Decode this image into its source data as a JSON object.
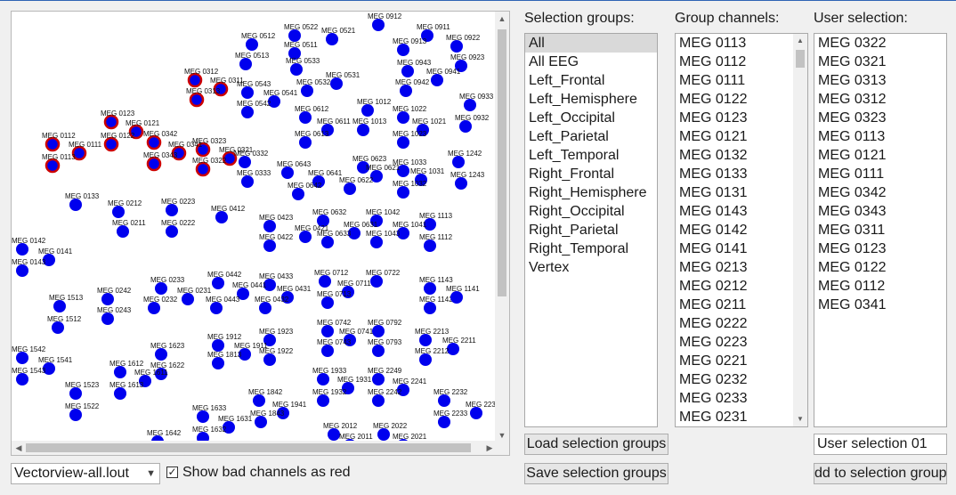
{
  "colors": {
    "sensor": "#0000ee",
    "bad": "#cc0000",
    "accent": "#2f64b4"
  },
  "headers": {
    "selection_groups": "Selection groups:",
    "group_channels": "Group channels:",
    "user_selection": "User selection:"
  },
  "selection_groups": [
    "All",
    "All EEG",
    "Left_Frontal",
    "Left_Hemisphere",
    "Left_Occipital",
    "Left_Parietal",
    "Left_Temporal",
    "Right_Frontal",
    "Right_Hemisphere",
    "Right_Occipital",
    "Right_Parietal",
    "Right_Temporal",
    "Vertex"
  ],
  "selected_group": "All",
  "group_channels": [
    "MEG 0113",
    "MEG 0112",
    "MEG 0111",
    "MEG 0122",
    "MEG 0123",
    "MEG 0121",
    "MEG 0132",
    "MEG 0133",
    "MEG 0131",
    "MEG 0143",
    "MEG 0142",
    "MEG 0141",
    "MEG 0213",
    "MEG 0212",
    "MEG 0211",
    "MEG 0222",
    "MEG 0223",
    "MEG 0221",
    "MEG 0232",
    "MEG 0233",
    "MEG 0231"
  ],
  "user_selection": [
    "MEG 0322",
    "MEG 0321",
    "MEG 0313",
    "MEG 0312",
    "MEG 0323",
    "MEG 0113",
    "MEG 0121",
    "MEG 0111",
    "MEG 0342",
    "MEG 0343",
    "MEG 0311",
    "MEG 0123",
    "MEG 0122",
    "MEG 0112",
    "MEG 0341"
  ],
  "buttons": {
    "load": "Load selection groups",
    "save": "Save selection groups",
    "add": "dd to selection group"
  },
  "new_group_name": "User selection 01",
  "layout_select": "Vectorview-all.lout",
  "checkbox_label": "Show bad channels as red",
  "checkbox_checked": true,
  "sensors": [
    {
      "id": "MEG 0522",
      "bad": false
    },
    {
      "id": "MEG 0912",
      "bad": false
    },
    {
      "id": "MEG 0911",
      "bad": false
    },
    {
      "id": "MEG 0521",
      "bad": false
    },
    {
      "id": "MEG 0913",
      "bad": false
    },
    {
      "id": "MEG 0922",
      "bad": false
    },
    {
      "id": "MEG 0512",
      "bad": false
    },
    {
      "id": "MEG 0511",
      "bad": false
    },
    {
      "id": "MEG 0923",
      "bad": false
    },
    {
      "id": "MEG 0513",
      "bad": false
    },
    {
      "id": "MEG 0533",
      "bad": false
    },
    {
      "id": "MEG 0943",
      "bad": false
    },
    {
      "id": "MEG 0941",
      "bad": false
    },
    {
      "id": "MEG 0312",
      "bad": true
    },
    {
      "id": "MEG 0311",
      "bad": true
    },
    {
      "id": "MEG 0313",
      "bad": true
    },
    {
      "id": "MEG 0543",
      "bad": false
    },
    {
      "id": "MEG 0541",
      "bad": false
    },
    {
      "id": "MEG 0532",
      "bad": false
    },
    {
      "id": "MEG 0531",
      "bad": false
    },
    {
      "id": "MEG 0942",
      "bad": false
    },
    {
      "id": "MEG 0933",
      "bad": false
    },
    {
      "id": "MEG 0542",
      "bad": false
    },
    {
      "id": "MEG 0612",
      "bad": false
    },
    {
      "id": "MEG 1012",
      "bad": false
    },
    {
      "id": "MEG 1022",
      "bad": false
    },
    {
      "id": "MEG 0932",
      "bad": false
    },
    {
      "id": "MEG 0123",
      "bad": true
    },
    {
      "id": "MEG 0121",
      "bad": true
    },
    {
      "id": "MEG 0342",
      "bad": true
    },
    {
      "id": "MEG 0611",
      "bad": false
    },
    {
      "id": "MEG 1013",
      "bad": false
    },
    {
      "id": "MEG 1021",
      "bad": false
    },
    {
      "id": "MEG 0112",
      "bad": true
    },
    {
      "id": "MEG 0122",
      "bad": true
    },
    {
      "id": "MEG 0323",
      "bad": true
    },
    {
      "id": "MEG 0613",
      "bad": false
    },
    {
      "id": "MEG 1023",
      "bad": false
    },
    {
      "id": "MEG 0111",
      "bad": true
    },
    {
      "id": "MEG 0341",
      "bad": true
    },
    {
      "id": "MEG 0321",
      "bad": true
    },
    {
      "id": "MEG 0113",
      "bad": true
    },
    {
      "id": "MEG 0343",
      "bad": true
    },
    {
      "id": "MEG 0322",
      "bad": true
    },
    {
      "id": "MEG 0332",
      "bad": false
    },
    {
      "id": "MEG 0623",
      "bad": false
    },
    {
      "id": "MEG 1033",
      "bad": false
    },
    {
      "id": "MEG 1242",
      "bad": false
    },
    {
      "id": "MEG 0333",
      "bad": false
    },
    {
      "id": "MEG 0643",
      "bad": false
    },
    {
      "id": "MEG 0641",
      "bad": false
    },
    {
      "id": "MEG 0621",
      "bad": false
    },
    {
      "id": "MEG 1031",
      "bad": false
    },
    {
      "id": "MEG 1243",
      "bad": false
    },
    {
      "id": "MEG 0642",
      "bad": false
    },
    {
      "id": "MEG 0622",
      "bad": false
    },
    {
      "id": "MEG 1032",
      "bad": false
    },
    {
      "id": "MEG 0133",
      "bad": false
    },
    {
      "id": "MEG 0212",
      "bad": false
    },
    {
      "id": "MEG 0223",
      "bad": false
    },
    {
      "id": "MEG 0412",
      "bad": false
    },
    {
      "id": "MEG 0632",
      "bad": false
    },
    {
      "id": "MEG 1042",
      "bad": false
    },
    {
      "id": "MEG 1113",
      "bad": false
    },
    {
      "id": "MEG 0211",
      "bad": false
    },
    {
      "id": "MEG 0222",
      "bad": false
    },
    {
      "id": "MEG 0423",
      "bad": false
    },
    {
      "id": "MEG 0421",
      "bad": false
    },
    {
      "id": "MEG 0631",
      "bad": false
    },
    {
      "id": "MEG 1041",
      "bad": false
    },
    {
      "id": "MEG 0633",
      "bad": false
    },
    {
      "id": "MEG 0422",
      "bad": false
    },
    {
      "id": "MEG 1043",
      "bad": false
    },
    {
      "id": "MEG 1112",
      "bad": false
    },
    {
      "id": "MEG 0142",
      "bad": false
    },
    {
      "id": "MEG 0141",
      "bad": false
    },
    {
      "id": "MEG 0143",
      "bad": false
    },
    {
      "id": "MEG 0233",
      "bad": false
    },
    {
      "id": "MEG 0442",
      "bad": false
    },
    {
      "id": "MEG 0433",
      "bad": false
    },
    {
      "id": "MEG 0712",
      "bad": false
    },
    {
      "id": "MEG 0722",
      "bad": false
    },
    {
      "id": "MEG 1143",
      "bad": false
    },
    {
      "id": "MEG 0242",
      "bad": false
    },
    {
      "id": "MEG 0231",
      "bad": false
    },
    {
      "id": "MEG 0441",
      "bad": false
    },
    {
      "id": "MEG 0431",
      "bad": false
    },
    {
      "id": "MEG 0711",
      "bad": false
    },
    {
      "id": "MEG 1513",
      "bad": false
    },
    {
      "id": "MEG 0232",
      "bad": false
    },
    {
      "id": "MEG 0443",
      "bad": false
    },
    {
      "id": "MEG 0432",
      "bad": false
    },
    {
      "id": "MEG 0713",
      "bad": false
    },
    {
      "id": "MEG 1142",
      "bad": false
    },
    {
      "id": "MEG 1141",
      "bad": false
    },
    {
      "id": "MEG 1512",
      "bad": false
    },
    {
      "id": "MEG 0243",
      "bad": false
    },
    {
      "id": "MEG 0742",
      "bad": false
    },
    {
      "id": "MEG 0792",
      "bad": false
    },
    {
      "id": "MEG 1912",
      "bad": false
    },
    {
      "id": "MEG 1923",
      "bad": false
    },
    {
      "id": "MEG 0741",
      "bad": false
    },
    {
      "id": "MEG 2213",
      "bad": false
    },
    {
      "id": "MEG 1623",
      "bad": false
    },
    {
      "id": "MEG 1911",
      "bad": false
    },
    {
      "id": "MEG 0743",
      "bad": false
    },
    {
      "id": "MEG 0793",
      "bad": false
    },
    {
      "id": "MEG 2211",
      "bad": false
    },
    {
      "id": "MEG 1542",
      "bad": false
    },
    {
      "id": "MEG 1541",
      "bad": false
    },
    {
      "id": "MEG 1813",
      "bad": false
    },
    {
      "id": "MEG 1922",
      "bad": false
    },
    {
      "id": "MEG 2212",
      "bad": false
    },
    {
      "id": "MEG 1543",
      "bad": false
    },
    {
      "id": "MEG 1612",
      "bad": false
    },
    {
      "id": "MEG 1622",
      "bad": false
    },
    {
      "id": "MEG 1933",
      "bad": false
    },
    {
      "id": "MEG 2249",
      "bad": false
    },
    {
      "id": "MEG 1611",
      "bad": false
    },
    {
      "id": "MEG 1931",
      "bad": false
    },
    {
      "id": "MEG 2241",
      "bad": false
    },
    {
      "id": "MEG 1523",
      "bad": false
    },
    {
      "id": "MEG 1613",
      "bad": false
    },
    {
      "id": "MEG 1842",
      "bad": false
    },
    {
      "id": "MEG 1932",
      "bad": false
    },
    {
      "id": "MEG 2242",
      "bad": false
    },
    {
      "id": "MEG 2232",
      "bad": false
    },
    {
      "id": "MEG 1522",
      "bad": false
    },
    {
      "id": "MEG 1941",
      "bad": false
    },
    {
      "id": "MEG 2231",
      "bad": false
    },
    {
      "id": "MEG 1633",
      "bad": false
    },
    {
      "id": "MEG 1843",
      "bad": false
    },
    {
      "id": "MEG 2233",
      "bad": false
    },
    {
      "id": "MEG 1631",
      "bad": false
    },
    {
      "id": "MEG 2012",
      "bad": false
    },
    {
      "id": "MEG 2022",
      "bad": false
    },
    {
      "id": "MEG 1632",
      "bad": false
    },
    {
      "id": "MEG 2011",
      "bad": false
    },
    {
      "id": "MEG 2021",
      "bad": false
    },
    {
      "id": "MEG 1642",
      "bad": false
    }
  ]
}
